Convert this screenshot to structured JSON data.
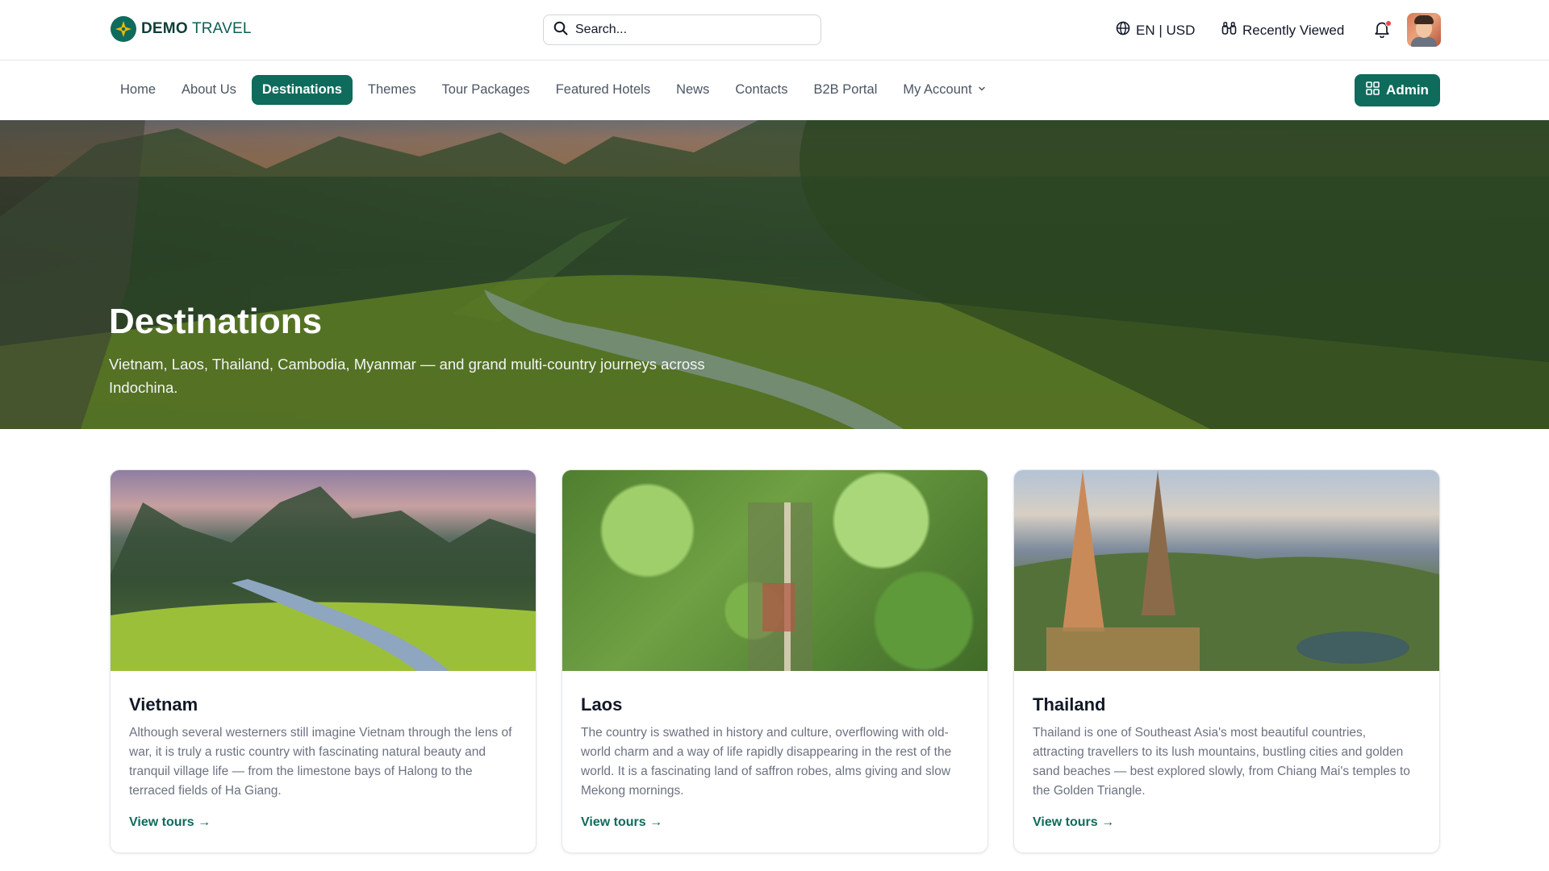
{
  "header": {
    "brand_bold": "DEMO",
    "brand_rest": "TRAVEL",
    "search_placeholder": "Search...",
    "locale": "EN | USD",
    "recently_viewed": "Recently Viewed"
  },
  "nav": {
    "items": [
      {
        "label": "Home"
      },
      {
        "label": "About Us"
      },
      {
        "label": "Destinations",
        "active": true
      },
      {
        "label": "Themes"
      },
      {
        "label": "Tour Packages"
      },
      {
        "label": "Featured Hotels"
      },
      {
        "label": "News"
      },
      {
        "label": "Contacts"
      },
      {
        "label": "B2B Portal"
      },
      {
        "label": "My Account",
        "has_dropdown": true
      }
    ],
    "admin_label": "Admin"
  },
  "hero": {
    "title": "Destinations",
    "subtitle": "Vietnam, Laos, Thailand, Cambodia, Myanmar — and grand multi-country journeys across Indochina."
  },
  "cards": [
    {
      "title": "Vietnam",
      "description": "Although several westerners still imagine Vietnam through the lens of war, it is truly a rustic country with fascinating natural beauty and tranquil village life — from the limestone bays of Halong to the terraced fields of Ha Giang.",
      "link": "View tours →"
    },
    {
      "title": "Laos",
      "description": "The country is swathed in history and culture, overflowing with old-world charm and a way of life rapidly disappearing in the rest of the world. It is a fascinating land of saffron robes, alms giving and slow Mekong mornings.",
      "link": "View tours →"
    },
    {
      "title": "Thailand",
      "description": "Thailand is one of Southeast Asia's most beautiful countries, attracting travellers to its lush mountains, bustling cities and golden sand beaches — best explored slowly, from Chiang Mai's temples to the Golden Triangle.",
      "link": "View tours →"
    }
  ],
  "colors": {
    "brand": "#0f6b5c",
    "notification": "#ef4444"
  },
  "icons": [
    "logo-compass-icon",
    "search-icon",
    "globe-icon",
    "binoculars-icon",
    "bell-icon",
    "chevron-down-icon",
    "grid-icon"
  ]
}
